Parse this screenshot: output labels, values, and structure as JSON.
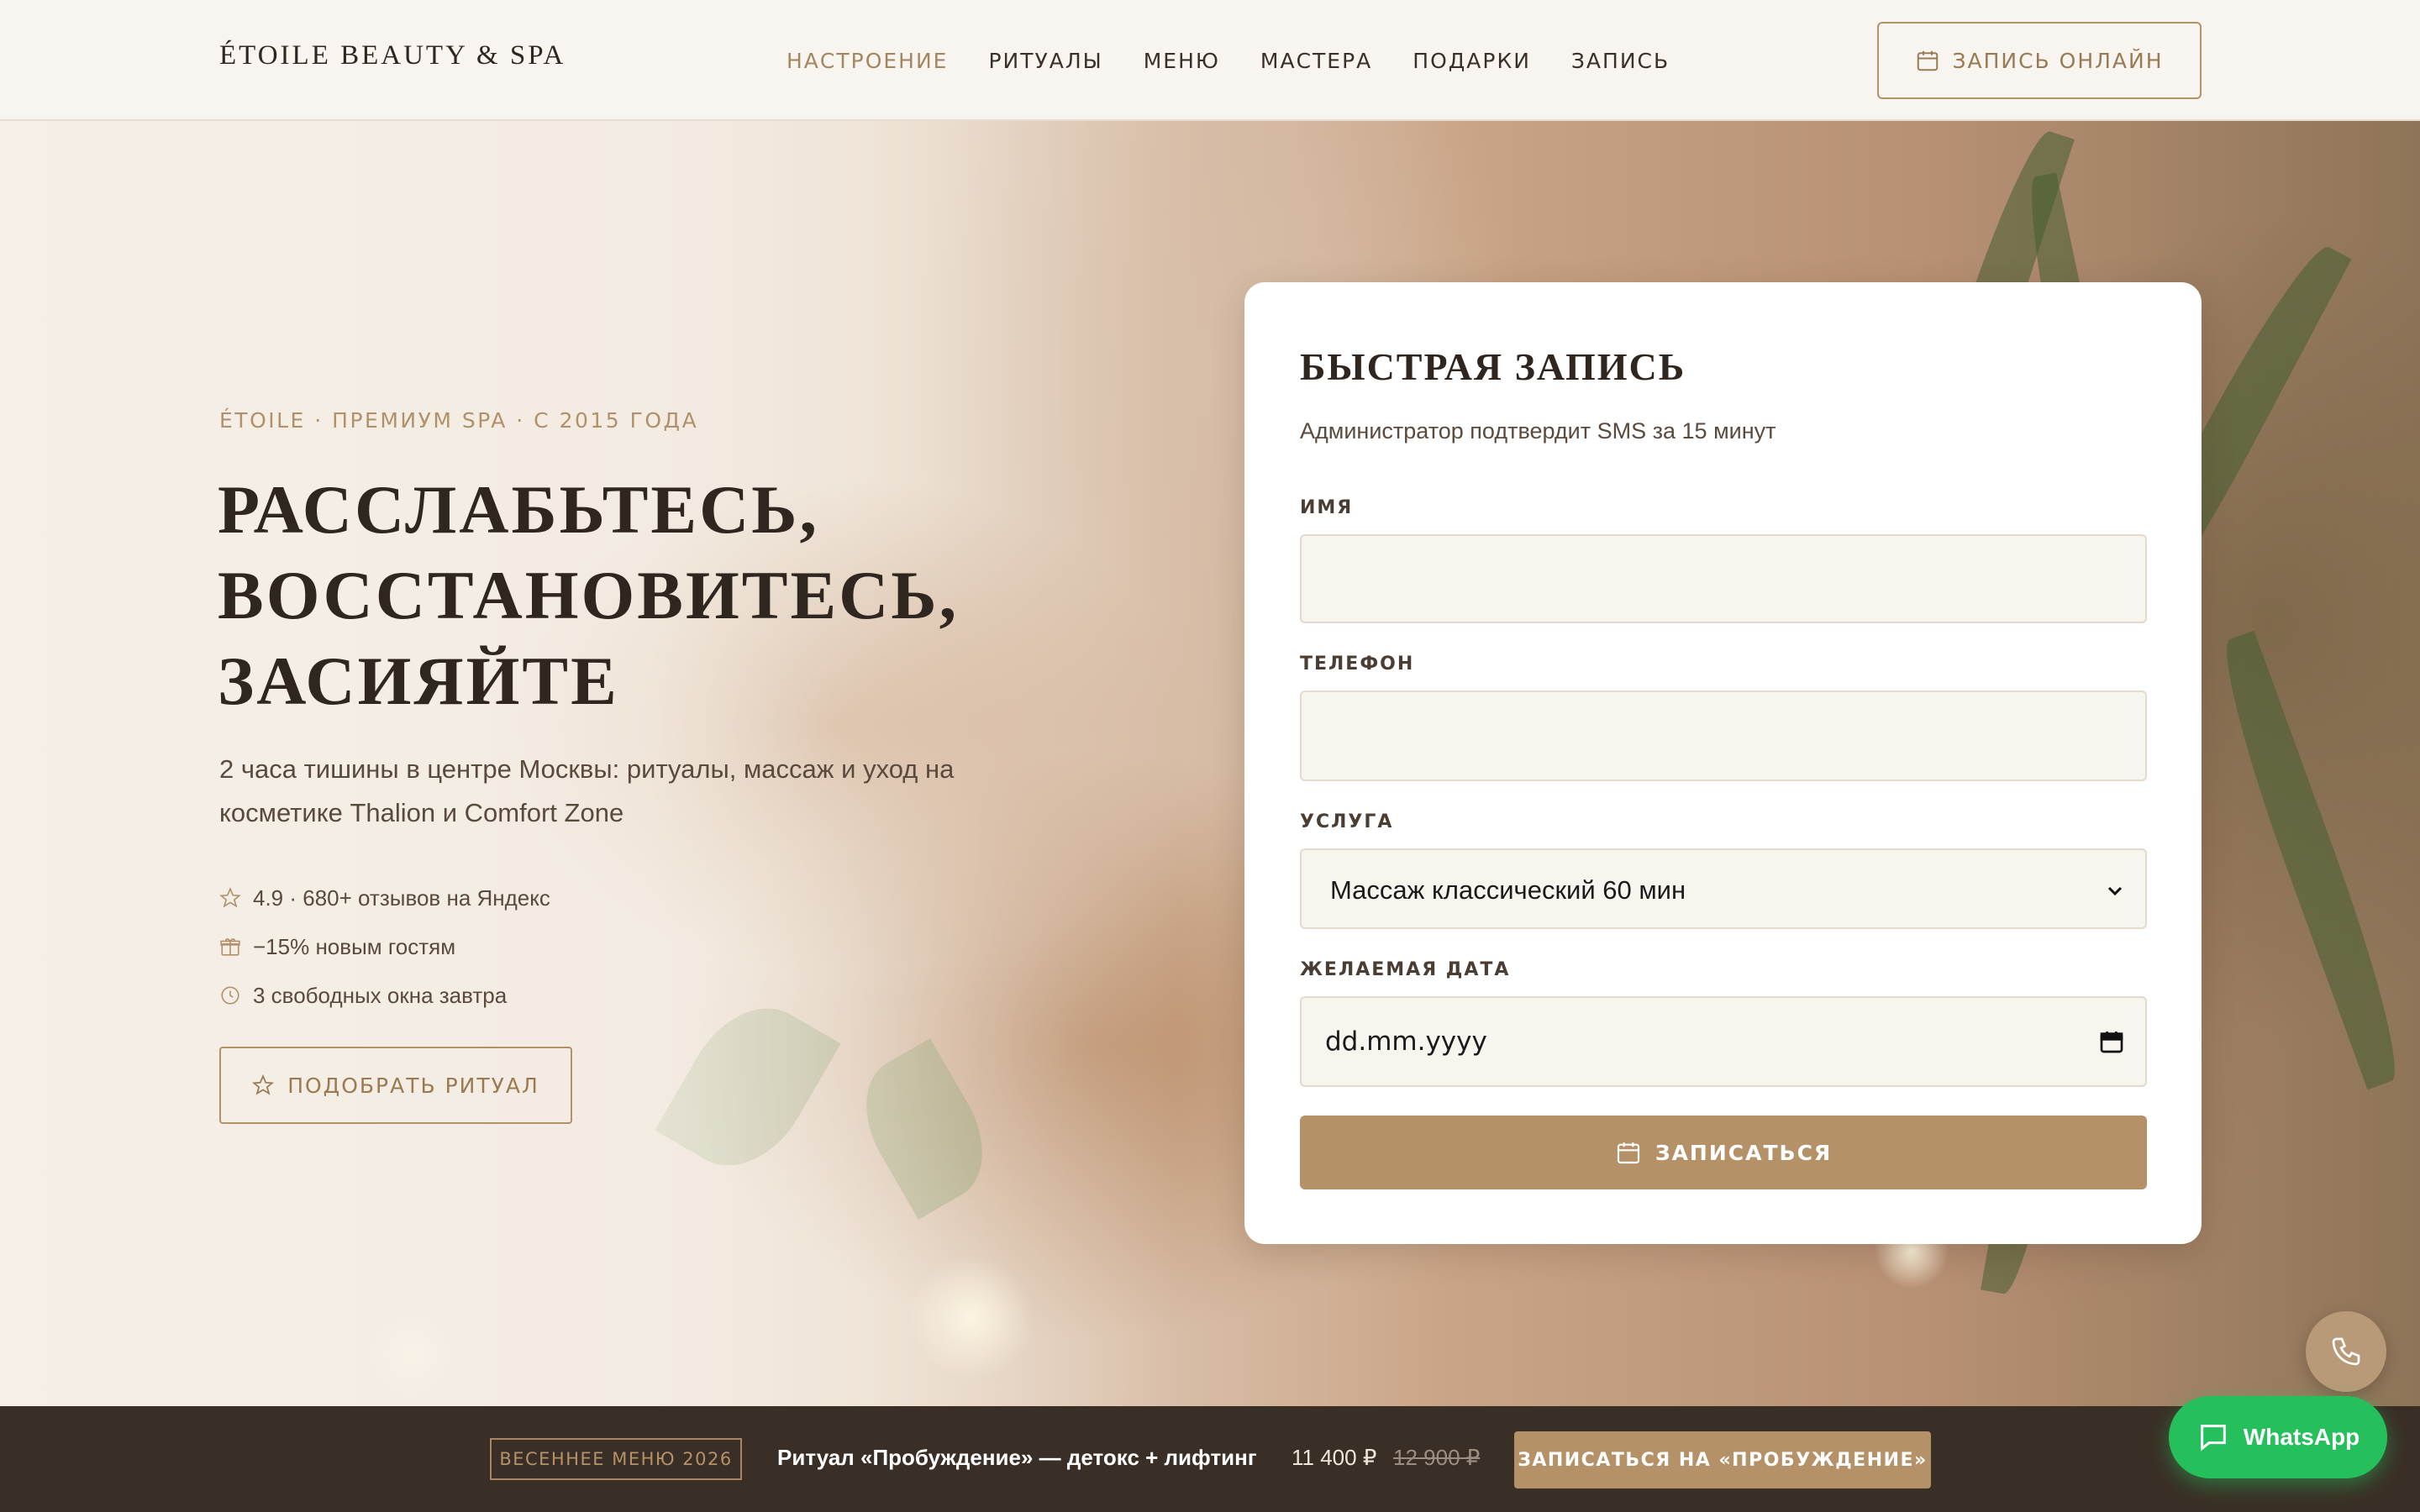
{
  "header": {
    "logo": "ÉTOILE BEAUTY & SPA",
    "nav": [
      "НАСТРОЕНИЕ",
      "РИТУАЛЫ",
      "МЕНЮ",
      "МАСТЕРА",
      "ПОДАРКИ",
      "ЗАПИСЬ"
    ],
    "active_nav": "НАСТРОЕНИЕ",
    "cta_label": "ЗАПИСЬ ОНЛАЙН"
  },
  "hero": {
    "eyebrow": "ÉTOILE · ПРЕМИУМ SPA · С 2015 ГОДА",
    "headline_lines": [
      "РАССЛАБЬТЕСЬ,",
      "ВОССТАНОВИТЕСЬ,",
      "ЗАСИЯЙТЕ"
    ],
    "subtitle": "2 часа тишины в центре Москвы: ритуалы, массаж и уход на косметике Thalion и Comfort Zone",
    "perks": [
      {
        "icon": "star-icon",
        "text": "4.9 · 680+ отзывов на Яндекс"
      },
      {
        "icon": "gift-icon",
        "text": "−15% новым гостям"
      },
      {
        "icon": "clock-icon",
        "text": "3 свободных окна завтра"
      }
    ],
    "pick_label": "ПОДОБРАТЬ РИТУАЛ"
  },
  "booking": {
    "title": "БЫСТРАЯ ЗАПИСЬ",
    "subtitle": "Администратор подтвердит SMS за 15 минут",
    "name_label": "ИМЯ",
    "name_value": "",
    "phone_label": "ТЕЛЕФОН",
    "phone_value": "",
    "service_label": "УСЛУГА",
    "service_value": "Массаж классический 60 мин",
    "date_label": "ЖЕЛАЕМАЯ ДАТА",
    "date_value": "dd.mm.yyyy",
    "submit_label": "ЗАПИСАТЬСЯ"
  },
  "promo": {
    "tag": "ВЕСЕННЕЕ МЕНЮ 2026",
    "title": "Ритуал «Пробуждение» — детокс + лифтинг",
    "price": "11 400 ₽",
    "old_price": "12 900 ₽",
    "cta": "ЗАПИСАТЬСЯ НА «ПРОБУЖДЕНИЕ»"
  },
  "floating": {
    "whatsapp_label": "WhatsApp",
    "phone_icon": "phone-icon"
  },
  "colors": {
    "accent": "#b59168",
    "dark": "#3a2f26",
    "whatsapp": "#25c05c"
  }
}
